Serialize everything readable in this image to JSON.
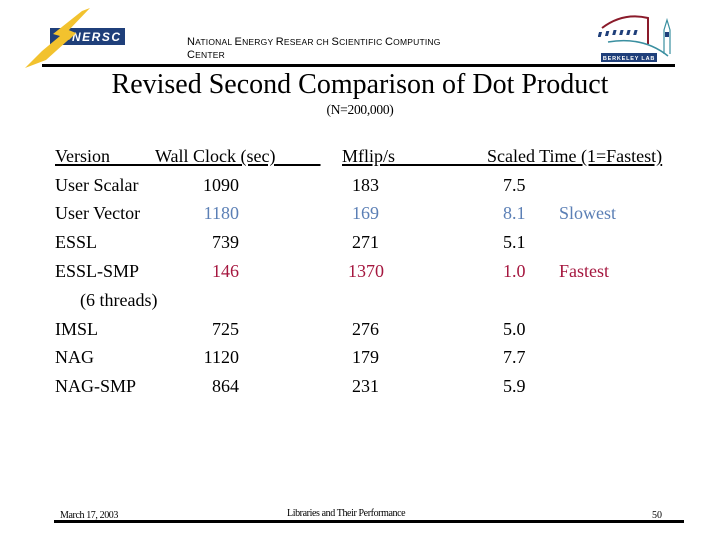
{
  "header": {
    "logo_left_text": "NERSC",
    "org_name_line1": [
      {
        "cap": "N",
        "rest": "ATIONAL "
      },
      {
        "cap": "E",
        "rest": "NERGY "
      },
      {
        "cap": "R",
        "rest": "ESEAR CH "
      },
      {
        "cap": "S",
        "rest": "CIENTIFIC "
      },
      {
        "cap": "C",
        "rest": "OMPUTING"
      }
    ],
    "org_name_line2": {
      "cap": "C",
      "rest": "ENTER"
    },
    "logo_right_text": "BERKELEY LAB"
  },
  "slide": {
    "title": "Revised Second Comparison of Dot Product",
    "subtitle": "(N=200,000)"
  },
  "table": {
    "headers": {
      "version": "Version",
      "wall_clock": "Wall Clock (sec)",
      "mflops": "Mflip/s",
      "scaled_time": "Scaled Time (1=Fastest)"
    },
    "rows": [
      {
        "version": "User Scalar",
        "wall_clock": "1090",
        "mflops": "183",
        "scaled": "7.5",
        "note": ""
      },
      {
        "version": "User Vector",
        "wall_clock": "1180",
        "mflops": "169",
        "scaled": "8.1",
        "note": "Slowest"
      },
      {
        "version": "ESSL",
        "wall_clock": "739",
        "mflops": "271",
        "scaled": "5.1",
        "note": ""
      },
      {
        "version": "ESSL-SMP",
        "wall_clock": "146",
        "mflops": "1370",
        "scaled": "1.0",
        "note": "Fastest"
      },
      {
        "version": "(6 threads)",
        "wall_clock": "",
        "mflops": "",
        "scaled": "",
        "note": ""
      },
      {
        "version": "IMSL",
        "wall_clock": "725",
        "mflops": "276",
        "scaled": "5.0",
        "note": ""
      },
      {
        "version": "NAG",
        "wall_clock": "1120",
        "mflops": "179",
        "scaled": "7.7",
        "note": ""
      },
      {
        "version": "NAG-SMP",
        "wall_clock": "864",
        "mflops": "231",
        "scaled": "5.9",
        "note": ""
      }
    ],
    "colors": {
      "slowest": "#5b7fb5",
      "fastest": "#a5173f"
    }
  },
  "footer": {
    "date": "March 17, 2003",
    "title": "Libraries and Their Performance",
    "page": "50"
  }
}
